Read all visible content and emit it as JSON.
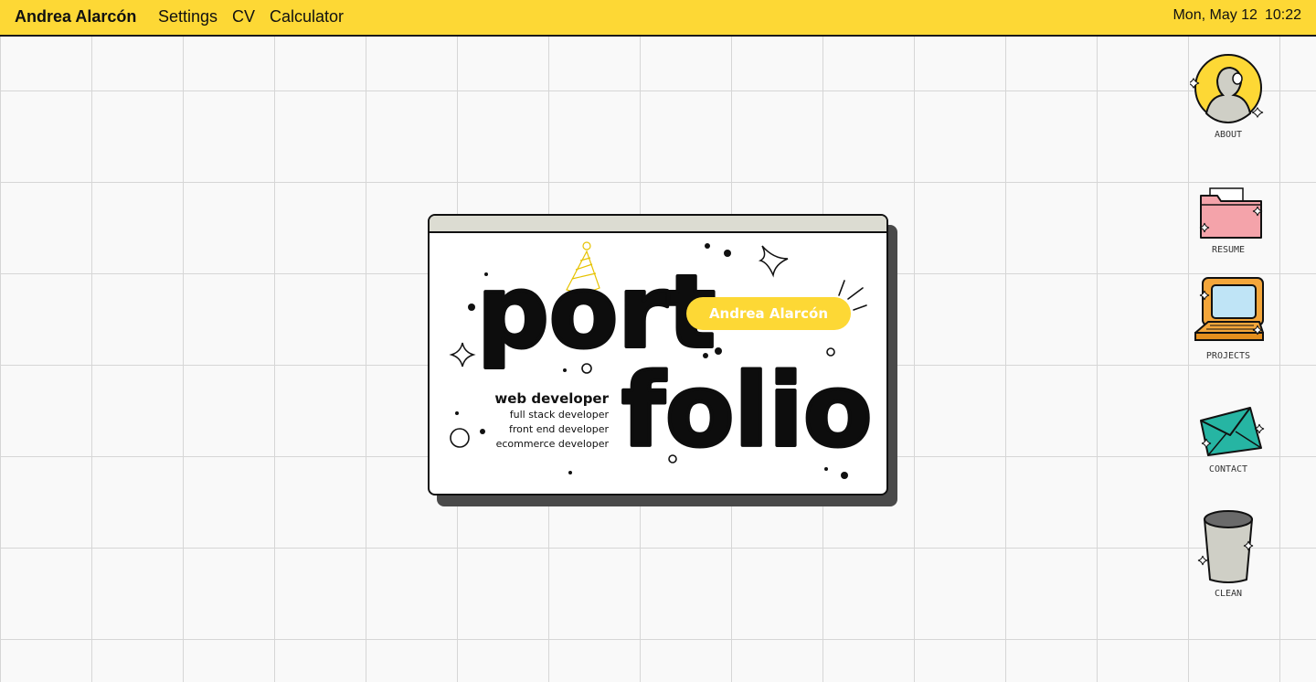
{
  "menubar": {
    "owner": "Andrea Alarcón",
    "items": [
      "Settings",
      "CV",
      "Calculator"
    ],
    "date": "Mon, May 12",
    "time": "10:22",
    "background": "#fdd835"
  },
  "window": {
    "word_top": "port",
    "word_bottom": "folio",
    "name_badge": "Andrea Alarcón",
    "role_main": "web developer",
    "roles": [
      "full stack developer",
      "front end developer",
      "ecommerce developer"
    ],
    "accent": "#fdd835"
  },
  "desktop_icons": [
    {
      "label": "ABOUT",
      "icon": "avatar-icon"
    },
    {
      "label": "RESUME",
      "icon": "folder-icon"
    },
    {
      "label": "PROJECTS",
      "icon": "computer-icon"
    },
    {
      "label": "CONTACT",
      "icon": "envelope-icon"
    },
    {
      "label": "CLEAN",
      "icon": "trash-icon"
    }
  ]
}
